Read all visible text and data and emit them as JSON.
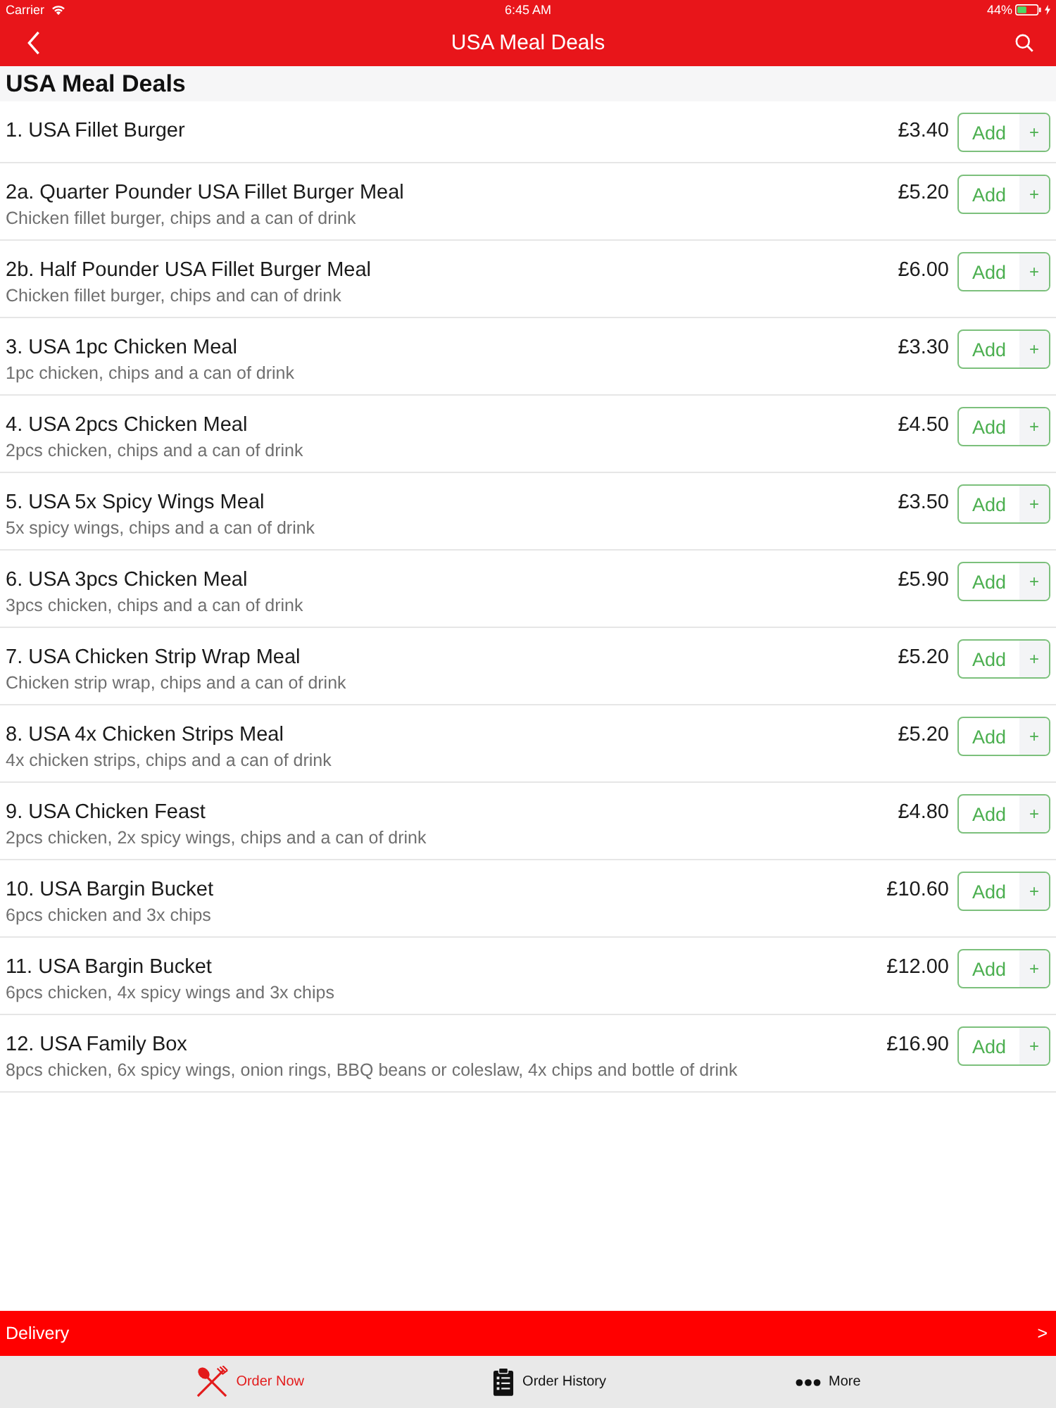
{
  "status_bar": {
    "carrier": "Carrier",
    "time": "6:45 AM",
    "battery": "44%"
  },
  "nav_bar": {
    "title": "USA Meal Deals"
  },
  "section": {
    "title": "USA Meal Deals"
  },
  "items": [
    {
      "name": "1. USA Fillet Burger",
      "price": "£3.40",
      "button": "Add",
      "plus": "+"
    },
    {
      "name": "2a. Quarter Pounder USA Fillet Burger Meal",
      "description": "Chicken fillet burger, chips and a can of drink",
      "price": "£5.20",
      "button": "Add",
      "plus": "+"
    },
    {
      "name": "2b. Half Pounder USA Fillet Burger Meal",
      "description": "Chicken fillet burger, chips and can of drink",
      "price": "£6.00",
      "button": "Add",
      "plus": "+"
    },
    {
      "name": "3. USA 1pc Chicken Meal",
      "description": "1pc chicken, chips and a can of drink",
      "price": "£3.30",
      "button": "Add",
      "plus": "+"
    },
    {
      "name": "4. USA 2pcs Chicken Meal",
      "description": "2pcs chicken, chips and a can of drink",
      "price": "£4.50",
      "button": "Add",
      "plus": "+"
    },
    {
      "name": "5. USA 5x Spicy Wings Meal",
      "description": "5x spicy wings, chips and a can of drink",
      "price": "£3.50",
      "button": "Add",
      "plus": "+"
    },
    {
      "name": "6. USA 3pcs Chicken Meal",
      "description": "3pcs chicken, chips and a can of drink",
      "price": "£5.90",
      "button": "Add",
      "plus": "+"
    },
    {
      "name": "7. USA Chicken Strip Wrap Meal",
      "description": "Chicken strip wrap, chips and a can of drink",
      "price": "£5.20",
      "button": "Add",
      "plus": "+"
    },
    {
      "name": "8. USA 4x Chicken Strips Meal",
      "description": "4x chicken strips, chips and a can of drink",
      "price": "£5.20",
      "button": "Add",
      "plus": "+"
    },
    {
      "name": "9. USA Chicken Feast",
      "description": "2pcs chicken, 2x spicy wings, chips and a can of drink",
      "price": "£4.80",
      "button": "Add",
      "plus": "+"
    },
    {
      "name": "10. USA Bargin Bucket",
      "description": "6pcs chicken and 3x chips",
      "price": "£10.60",
      "button": "Add",
      "plus": "+"
    },
    {
      "name": "11. USA Bargin Bucket",
      "description": "6pcs chicken, 4x spicy wings and 3x chips",
      "price": "£12.00",
      "button": "Add",
      "plus": "+"
    },
    {
      "name": "12. USA Family Box",
      "description": "8pcs chicken, 6x spicy wings, onion rings, BBQ beans or coleslaw, 4x chips and bottle of drink",
      "price": "£16.90",
      "button": "Add",
      "plus": "+"
    }
  ],
  "delivery_bar": {
    "label": "Delivery",
    "chevron": ">"
  },
  "tabs": [
    {
      "kind": "cutlery",
      "label": "Order Now",
      "selected": true
    },
    {
      "kind": "clipboard",
      "label": "Order History",
      "selected": false
    },
    {
      "kind": "dots",
      "label": "More",
      "selected": false
    }
  ]
}
